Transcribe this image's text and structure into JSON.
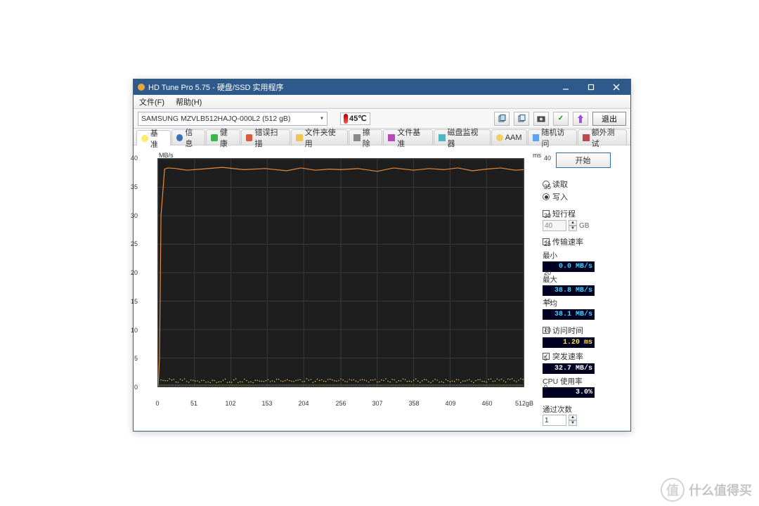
{
  "title": "HD Tune Pro 5.75 - 硬盘/SSD 实用程序",
  "menu": {
    "file": "文件(F)",
    "help": "帮助(H)"
  },
  "toolbar1": {
    "drive": "SAMSUNG MZVLB512HAJQ-000L2 (512 gB)",
    "temp": "45℃",
    "exit": "退出"
  },
  "tabs": [
    "基准",
    "信息",
    "健康",
    "错误扫描",
    "文件夹使用",
    "擦除",
    "文件基准",
    "磁盘监视器",
    "AAM",
    "随机访问",
    "额外测试"
  ],
  "side": {
    "start": "开始",
    "read": "读取",
    "write": "写入",
    "short_stroke": "短行程",
    "short_stroke_val": "40",
    "unit_gb": "GB",
    "transfer_rate": "传输速率",
    "min_lbl": "最小",
    "min_val": "0.0 MB/s",
    "max_lbl": "最大",
    "max_val": "38.8 MB/s",
    "avg_lbl": "平均",
    "avg_val": "38.1 MB/s",
    "access_time": "访问时间",
    "access_val": "1.20 ms",
    "burst_rate": "突发速率",
    "burst_val": "32.7 MB/s",
    "cpu_usage": "CPU 使用率",
    "cpu_val": "3.0%",
    "passes_lbl": "通过次数",
    "passes_val": "1"
  },
  "chart_data": {
    "type": "line",
    "title": "",
    "xlabel": "gB",
    "ylabel_left": "MB/s",
    "ylabel_right": "ms",
    "x_ticks": [
      0,
      51,
      102,
      153,
      204,
      256,
      307,
      358,
      409,
      460,
      512
    ],
    "y_left_ticks": [
      0,
      5,
      10,
      15,
      20,
      25,
      30,
      35,
      40
    ],
    "y_right_ticks": [
      0,
      5,
      10,
      15,
      20,
      25,
      30,
      35,
      40
    ],
    "xlim": [
      0,
      512
    ],
    "ylim_left": [
      0,
      40
    ],
    "ylim_right": [
      0,
      40
    ],
    "series": [
      {
        "name": "传输速率 (MB/s)",
        "axis": "left",
        "color": "#e88b3c",
        "x": [
          0,
          2,
          4,
          9,
          14,
          25,
          40,
          60,
          90,
          120,
          150,
          180,
          200,
          220,
          240,
          256,
          280,
          307,
          330,
          358,
          380,
          400,
          420,
          440,
          460,
          480,
          500,
          512
        ],
        "values": [
          0,
          5,
          30,
          38.2,
          38.4,
          38.3,
          38.0,
          38.2,
          38.5,
          38.1,
          38.3,
          37.9,
          38.4,
          38.0,
          38.2,
          38.1,
          38.3,
          37.8,
          38.4,
          38.0,
          38.3,
          38.1,
          38.4,
          37.9,
          38.2,
          38.4,
          38.0,
          38.1
        ]
      },
      {
        "name": "访问时间 (ms)",
        "axis": "right",
        "color": "#ffe74a",
        "x": [
          0,
          51,
          102,
          153,
          204,
          256,
          307,
          358,
          409,
          460,
          512
        ],
        "values": [
          1.2,
          1.2,
          1.2,
          1.2,
          1.2,
          1.2,
          1.2,
          1.2,
          1.2,
          1.2,
          1.2
        ]
      }
    ]
  },
  "watermark": "什么值得买"
}
